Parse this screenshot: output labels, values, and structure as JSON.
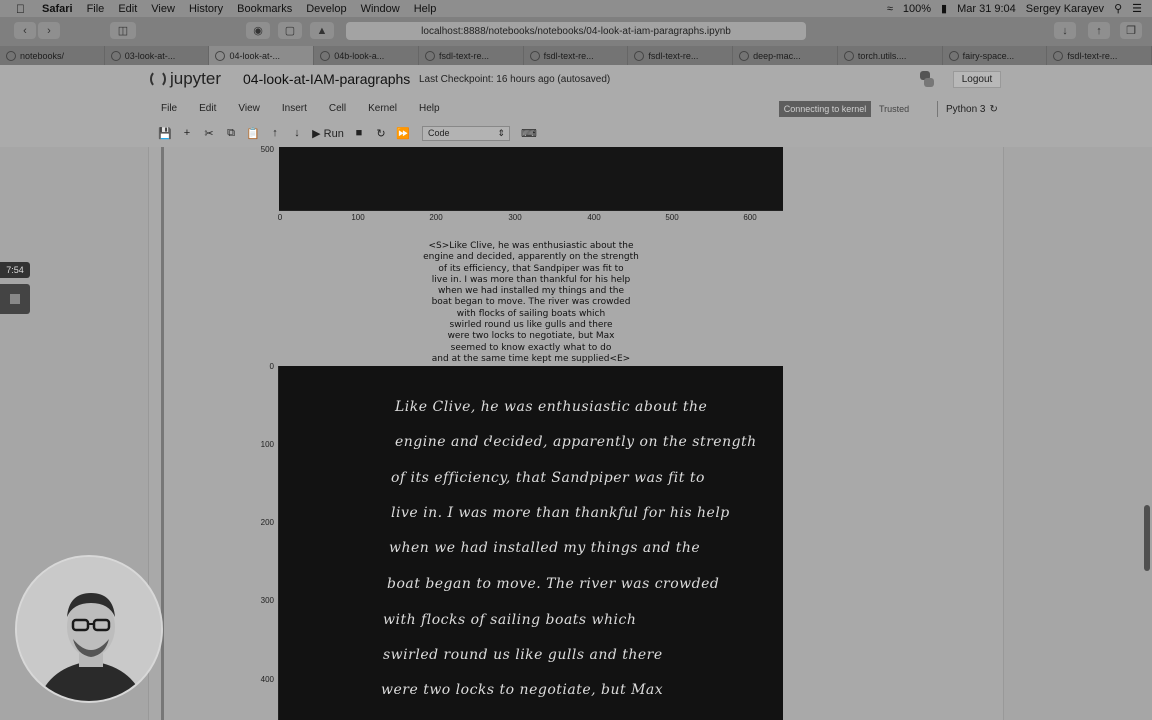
{
  "mac_menubar": {
    "app": "Safari",
    "items": [
      "File",
      "Edit",
      "View",
      "History",
      "Bookmarks",
      "Develop",
      "Window",
      "Help"
    ],
    "battery": "100%",
    "clock": "Mar 31  9:04",
    "user": "Sergey Karayev"
  },
  "browser": {
    "url": "localhost:8888/notebooks/notebooks/04-look-at-iam-paragraphs.ipynb",
    "tabs": [
      "notebooks/",
      "03-look-at-...",
      "04-look-at-...",
      "04b-look-a...",
      "fsdl-text-re...",
      "fsdl-text-re...",
      "fsdl-text-re...",
      "deep-mac...",
      "torch.utils....",
      "fairy-space...",
      "fsdl-text-re..."
    ],
    "active_tab_index": 2
  },
  "jupyter": {
    "logo_text": "jupyter",
    "notebook_title": "04-look-at-IAM-paragraphs",
    "checkpoint": "Last Checkpoint: 16 hours ago  (autosaved)",
    "logout_label": "Logout",
    "menu": [
      "File",
      "Edit",
      "View",
      "Insert",
      "Cell",
      "Kernel",
      "Help"
    ],
    "kernel_status": "Connecting to kernel",
    "trusted": "Trusted",
    "kernel_name": "Python 3",
    "run_label": "Run",
    "cell_type": "Code"
  },
  "plot_top": {
    "y_tick": "500",
    "x_ticks": [
      "0",
      "100",
      "200",
      "300",
      "400",
      "500",
      "600"
    ]
  },
  "paragraph_text": [
    "<S>Like Clive, he was enthusiastic about the",
    "engine and decided, apparently on the strength",
    "of its efficiency, that Sandpiper was fit to",
    "live in. I was more than thankful for his help",
    "when we had installed my things and the",
    "boat began to move. The river was crowded",
    "with flocks of sailing boats which",
    "swirled round us like gulls and there",
    "were two locks to negotiate, but Max",
    "seemed to know exactly what to do",
    "and at the same time kept me supplied<E>"
  ],
  "plot_bottom": {
    "y_ticks": [
      "0",
      "100",
      "200",
      "300",
      "400"
    ],
    "handwriting_lines": [
      "Like Clive, he was enthusiastic about the",
      "engine and decided, apparently on the strength",
      "of its efficiency, that Sandpiper was fit to",
      "live in. I was more than thankful for his help",
      "when we had installed my things and the",
      "boat began to move. The river was crowded",
      "with flocks of sailing boats which",
      "swirled round us like gulls and there",
      "were two locks to negotiate, but Max"
    ]
  },
  "recording": {
    "timer": "7:54"
  }
}
